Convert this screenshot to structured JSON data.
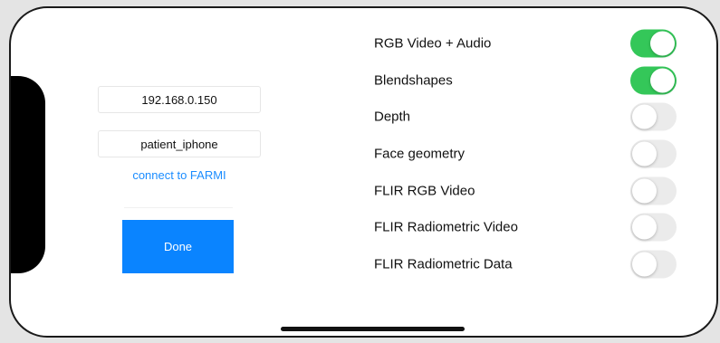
{
  "connection": {
    "ip_address": "192.168.0.150",
    "device_name": "patient_iphone",
    "connect_link": "connect to FARMI",
    "done_label": "Done"
  },
  "settings": [
    {
      "label": "RGB Video + Audio",
      "enabled": true
    },
    {
      "label": "Blendshapes",
      "enabled": true
    },
    {
      "label": "Depth",
      "enabled": false
    },
    {
      "label": "Face geometry",
      "enabled": false
    },
    {
      "label": "FLIR RGB Video",
      "enabled": false
    },
    {
      "label": "FLIR Radiometric Video",
      "enabled": false
    },
    {
      "label": "FLIR Radiometric Data",
      "enabled": false
    }
  ],
  "colors": {
    "toggle_on": "#34c759",
    "toggle_off": "#ebebeb",
    "button_blue": "#0a84ff",
    "link_blue": "#1a8cff"
  }
}
